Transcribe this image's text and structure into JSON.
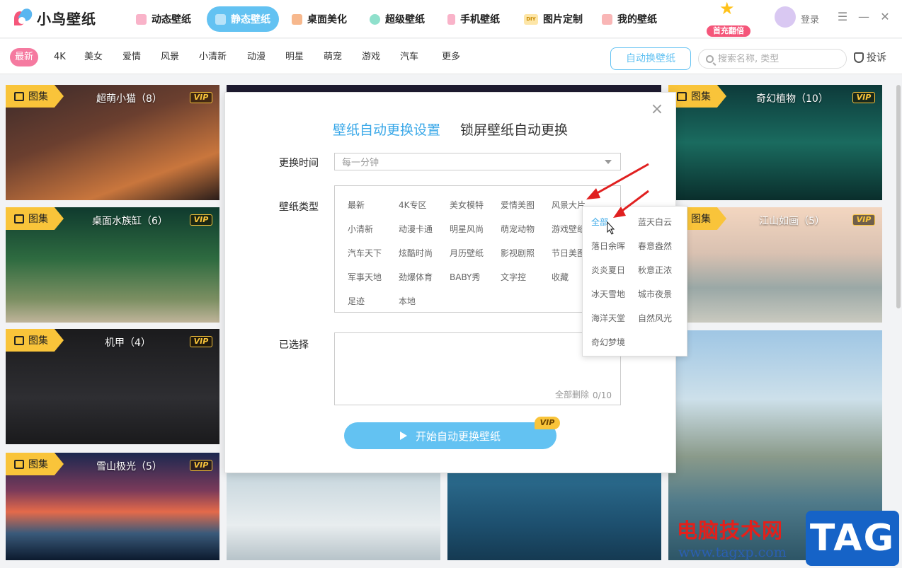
{
  "app": {
    "name": "小鸟壁纸",
    "login": "登录"
  },
  "nav": [
    {
      "label": "动态壁纸",
      "color": "#f57aa0"
    },
    {
      "label": "静态壁纸",
      "color": "#ffffff"
    },
    {
      "label": "桌面美化",
      "color": "#f5954a"
    },
    {
      "label": "超级壁纸",
      "color": "#3cc7a6"
    },
    {
      "label": "手机壁纸",
      "color": "#f57aa0"
    },
    {
      "label": "图片定制",
      "color": "#f9c43a",
      "icon_text": "DIY"
    },
    {
      "label": "我的壁纸",
      "color": "#f58a8a"
    }
  ],
  "promo": {
    "label": "首充翻倍"
  },
  "categories": [
    "最新",
    "4K",
    "美女",
    "爱情",
    "风景",
    "小清新",
    "动漫",
    "明星",
    "萌宠",
    "游戏",
    "汽车",
    "更多"
  ],
  "toolbar": {
    "auto_label": "自动换壁纸",
    "search_placeholder": "搜索名称, 类型",
    "report_label": "投诉"
  },
  "cards": [
    {
      "badge": "图集",
      "title": "超萌小猫（8）",
      "vip": "VIP"
    },
    {
      "badge": "图集",
      "title": "桌面水族缸（6）",
      "vip": "VIP"
    },
    {
      "badge": "图集",
      "title": "机甲（4）",
      "vip": "VIP"
    },
    {
      "badge": "图集",
      "title": "雪山极光（5）",
      "vip": "VIP"
    },
    {
      "badge": "图集",
      "title": "奇幻植物（10）",
      "vip": "VIP"
    },
    {
      "badge": "图集",
      "title": "江山如画（5）",
      "vip": "VIP"
    }
  ],
  "dialog": {
    "tab_active": "壁纸自动更换设置",
    "tab_inactive": "锁屏壁纸自动更换",
    "interval_label": "更换时间",
    "interval_value": "每一分钟",
    "type_label": "壁纸类型",
    "types": [
      "最新",
      "4K专区",
      "美女模特",
      "爱情美图",
      "风景大片",
      "小清新",
      "动漫卡通",
      "明星风尚",
      "萌宠动物",
      "游戏壁纸",
      "汽车天下",
      "炫酷时尚",
      "月历壁纸",
      "影视剧照",
      "节日美图",
      "军事天地",
      "劲爆体育",
      "BABY秀",
      "文字控",
      "收藏",
      "足迹",
      "本地"
    ],
    "selected_label": "已选择",
    "clear_label": "全部删除",
    "count": "0/10",
    "start_label": "开始自动更换壁纸",
    "start_vip": "VIP"
  },
  "submenu": [
    "全部",
    "蓝天白云",
    "落日余晖",
    "春意盎然",
    "炎炎夏日",
    "秋意正浓",
    "冰天雪地",
    "城市夜景",
    "海洋天堂",
    "自然风光",
    "奇幻梦境"
  ],
  "watermark": {
    "line1": "电脑技术网",
    "line2": "www.tagxp.com",
    "tag": "TAG"
  }
}
